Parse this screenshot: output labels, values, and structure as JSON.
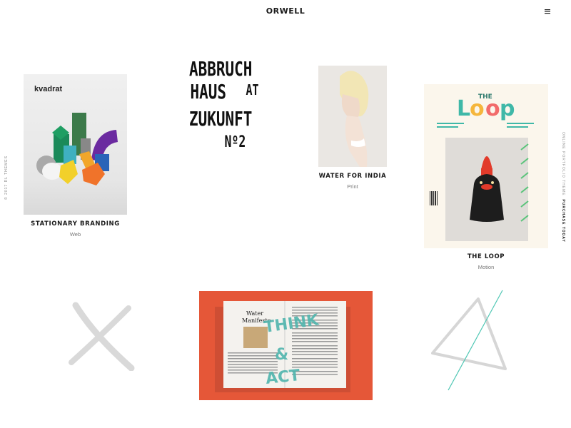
{
  "header": {
    "logo": "ORWELL",
    "menu_icon": "hamburger-menu-icon"
  },
  "sidebar_left": {
    "text": "© 2017 RL THEMES"
  },
  "sidebar_right": {
    "text": "ONLINE PORTFOLIO THEME",
    "link": "PURCHASE TODAY"
  },
  "portfolio": {
    "items": [
      {
        "title": "STATIONARY BRANDING",
        "category": "Web",
        "image_text": "kvadrat"
      },
      {
        "title": "",
        "category": "",
        "image_text": "ABBRUCH HAUS AT ZUKUNFT Nº2"
      },
      {
        "title": "WATER FOR INDIA",
        "category": "Print"
      },
      {
        "title": "THE LOOP",
        "category": "Motion",
        "image_text": "THE Loop"
      },
      {
        "title": "",
        "category": "",
        "image_text": "Water Manifesto THINK & ACT"
      }
    ]
  },
  "colors": {
    "accent_orange": "#e55738",
    "loop_teal": "#3fb8a8",
    "loop_pink": "#f26b6b",
    "manifesto_teal": "#4fb5ad"
  }
}
